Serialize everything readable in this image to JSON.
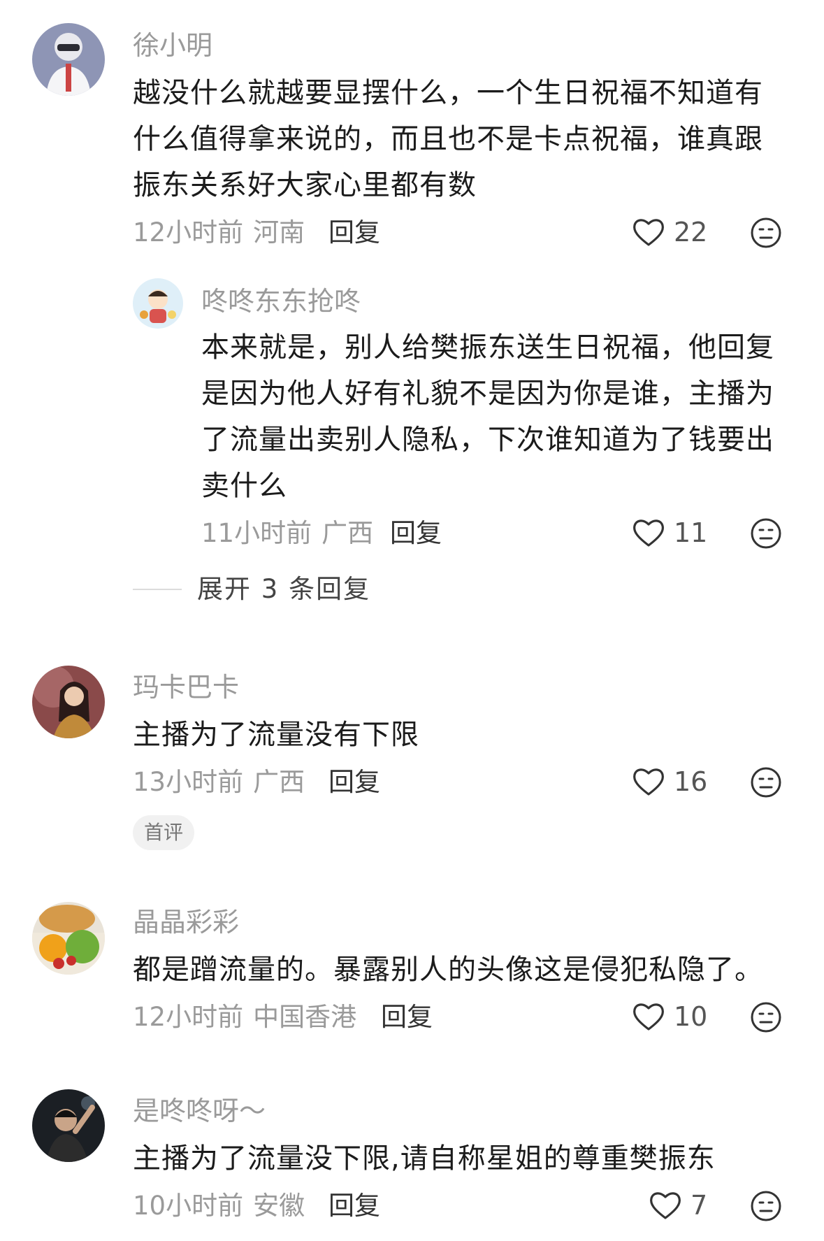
{
  "comments": [
    {
      "username": "徐小明",
      "text": "越没什么就越要显摆什么，一个生日祝福不知道有什么值得拿来说的，而且也不是卡点祝福，谁真跟振东关系好大家心里都有数",
      "time": "12小时前",
      "location": "河南",
      "reply_label": "回复",
      "likes": "22",
      "avatar_icon": "avatar-helmet-icon"
    },
    {
      "username": "咚咚东东抢咚",
      "text": "本来就是，别人给樊振东送生日祝福，他回复是因为他人好有礼貌不是因为你是谁，主播为了流量出卖别人隐私，下次谁知道为了钱要出卖什么",
      "time": "11小时前",
      "location": "广西",
      "reply_label": "回复",
      "likes": "11",
      "avatar_icon": "avatar-cartoon-icon"
    },
    {
      "username": "玛卡巴卡",
      "text": "主播为了流量没有下限",
      "time": "13小时前",
      "location": "广西",
      "reply_label": "回复",
      "likes": "16",
      "badge": "首评",
      "avatar_icon": "avatar-portrait-icon"
    },
    {
      "username": "晶晶彩彩",
      "text": "都是蹭流量的。暴露别人的头像这是侵犯私隐了。",
      "time": "12小时前",
      "location": "中国香港",
      "reply_label": "回复",
      "likes": "10",
      "avatar_icon": "avatar-food-icon"
    },
    {
      "username": "是咚咚呀～",
      "text": "主播为了流量没下限,请自称星姐的尊重樊振东",
      "time": "10小时前",
      "location": "安徽",
      "reply_label": "回复",
      "likes": "7",
      "avatar_icon": "avatar-concert-icon"
    }
  ],
  "expand_replies": "展开 3 条回复",
  "colors": {
    "username": "#9a9a9a",
    "body": "#1b1b1b",
    "meta": "#9a9a9a",
    "badge_bg": "#f1f1f1"
  }
}
